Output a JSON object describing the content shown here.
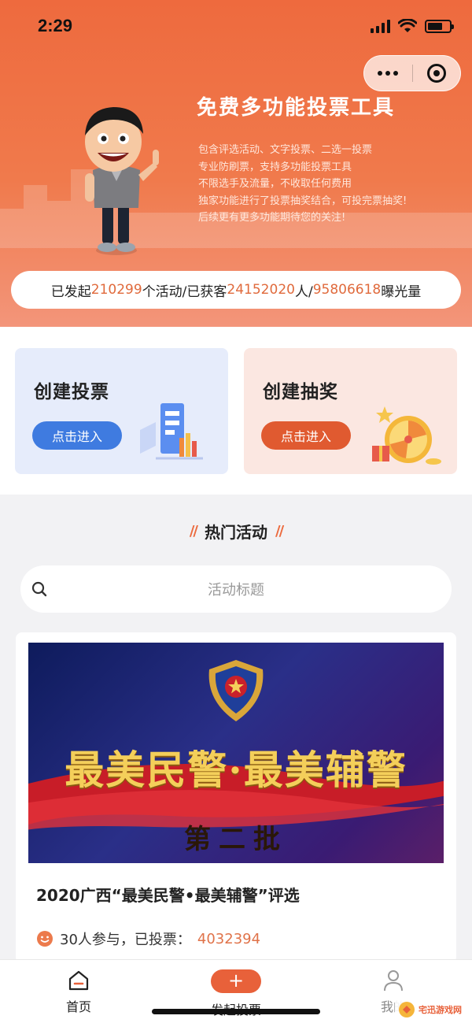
{
  "status_bar": {
    "time": "2:29"
  },
  "hero": {
    "title": "免费多功能投票工具",
    "description": [
      "包含评选活动、文字投票、二选一投票",
      "专业防刷票，支持多功能投票工具",
      "不限选手及流量，不收取任何费用",
      "独家功能进行了投票抽奖结合，可投完票抽奖!",
      "后续更有更多功能期待您的关注!"
    ]
  },
  "stats": {
    "prefix": "已发起",
    "activities": "210299",
    "mid1": "个活动/已获客",
    "customers": "24152020",
    "mid2": "人/",
    "exposure": "95806618",
    "suffix": "曝光量"
  },
  "cards": {
    "vote": {
      "title": "创建投票",
      "button": "点击进入"
    },
    "lottery": {
      "title": "创建抽奖",
      "button": "点击进入"
    }
  },
  "hot": {
    "title": "热门活动",
    "search_placeholder": "活动标题"
  },
  "activity": {
    "banner_title": "最美民警·最美辅警",
    "banner_subtitle": "第二批",
    "title": "2020广西“最美民警•最美辅警”评选",
    "participants": "30人参与，已投票：",
    "votes": "4032394"
  },
  "tabbar": {
    "home": "首页",
    "publish": "发起投票",
    "mine": "我的"
  },
  "watermark": {
    "text": "宅迅游戏网"
  },
  "colors": {
    "brand": "#e8613a",
    "accent_blue": "#3f7be0",
    "number": "#e06a3c"
  }
}
